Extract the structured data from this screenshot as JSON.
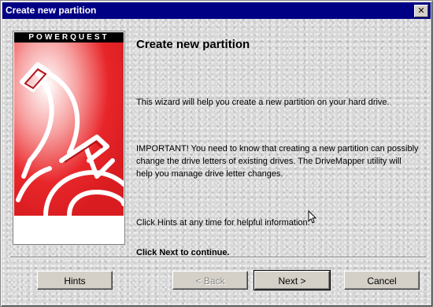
{
  "window": {
    "title": "Create new partition",
    "close_glyph": "✕"
  },
  "banner": {
    "brand": "POWERQUEST"
  },
  "main": {
    "heading": "Create new partition",
    "intro": "This wizard will help you create a new partition on your hard drive.",
    "important": "IMPORTANT! You need to know that creating a new partition can possibly change the drive letters of existing drives. The DriveMapper utility will help you manage drive letter changes.",
    "hints_text": "Click Hints at any time for helpful information.",
    "next_text": "Click Next to continue."
  },
  "buttons": {
    "hints": "Hints",
    "back": "< Back",
    "next": "Next >",
    "cancel": "Cancel"
  },
  "colors": {
    "titlebar": "#000084",
    "accent_red": "#e8262a"
  }
}
